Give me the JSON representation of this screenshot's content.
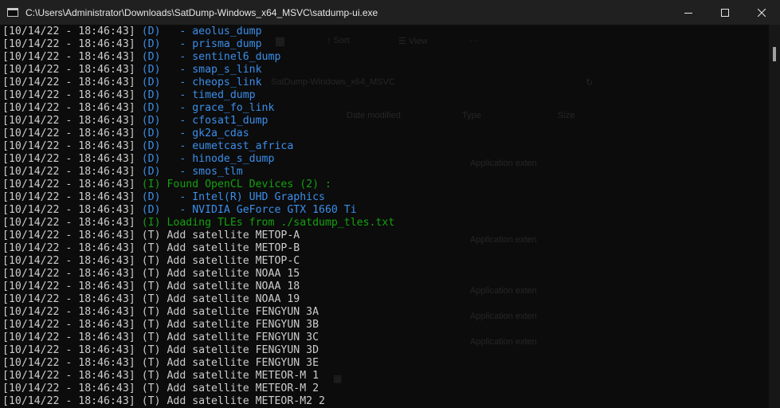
{
  "window": {
    "title": "C:\\Users\\Administrator\\Downloads\\SatDump-Windows_x64_MSVC\\satdump-ui.exe"
  },
  "colors": {
    "debug": "#3b8eea",
    "info": "#13a10e",
    "trace": "#cccccc"
  },
  "console": {
    "lines": [
      {
        "ts": "[10/14/22 - 18:46:43]",
        "level": "(D)",
        "msg": "  - aeolus_dump"
      },
      {
        "ts": "[10/14/22 - 18:46:43]",
        "level": "(D)",
        "msg": "  - prisma_dump"
      },
      {
        "ts": "[10/14/22 - 18:46:43]",
        "level": "(D)",
        "msg": "  - sentinel6_dump"
      },
      {
        "ts": "[10/14/22 - 18:46:43]",
        "level": "(D)",
        "msg": "  - smap_s_link"
      },
      {
        "ts": "[10/14/22 - 18:46:43]",
        "level": "(D)",
        "msg": "  - cheops_link"
      },
      {
        "ts": "[10/14/22 - 18:46:43]",
        "level": "(D)",
        "msg": "  - timed_dump"
      },
      {
        "ts": "[10/14/22 - 18:46:43]",
        "level": "(D)",
        "msg": "  - grace_fo_link"
      },
      {
        "ts": "[10/14/22 - 18:46:43]",
        "level": "(D)",
        "msg": "  - cfosat1_dump"
      },
      {
        "ts": "[10/14/22 - 18:46:43]",
        "level": "(D)",
        "msg": "  - gk2a_cdas"
      },
      {
        "ts": "[10/14/22 - 18:46:43]",
        "level": "(D)",
        "msg": "  - eumetcast_africa"
      },
      {
        "ts": "[10/14/22 - 18:46:43]",
        "level": "(D)",
        "msg": "  - hinode_s_dump"
      },
      {
        "ts": "[10/14/22 - 18:46:43]",
        "level": "(D)",
        "msg": "  - smos_tlm"
      },
      {
        "ts": "[10/14/22 - 18:46:43]",
        "level": "(I)",
        "msg": "Found OpenCL Devices (2) :"
      },
      {
        "ts": "[10/14/22 - 18:46:43]",
        "level": "(D)",
        "msg": "  - Intel(R) UHD Graphics"
      },
      {
        "ts": "[10/14/22 - 18:46:43]",
        "level": "(D)",
        "msg": "  - NVIDIA GeForce GTX 1660 Ti"
      },
      {
        "ts": "[10/14/22 - 18:46:43]",
        "level": "(I)",
        "msg": "Loading TLEs from ./satdump_tles.txt"
      },
      {
        "ts": "[10/14/22 - 18:46:43]",
        "level": "(T)",
        "msg": "Add satellite METOP-A"
      },
      {
        "ts": "[10/14/22 - 18:46:43]",
        "level": "(T)",
        "msg": "Add satellite METOP-B"
      },
      {
        "ts": "[10/14/22 - 18:46:43]",
        "level": "(T)",
        "msg": "Add satellite METOP-C"
      },
      {
        "ts": "[10/14/22 - 18:46:43]",
        "level": "(T)",
        "msg": "Add satellite NOAA 15"
      },
      {
        "ts": "[10/14/22 - 18:46:43]",
        "level": "(T)",
        "msg": "Add satellite NOAA 18"
      },
      {
        "ts": "[10/14/22 - 18:46:43]",
        "level": "(T)",
        "msg": "Add satellite NOAA 19"
      },
      {
        "ts": "[10/14/22 - 18:46:43]",
        "level": "(T)",
        "msg": "Add satellite FENGYUN 3A"
      },
      {
        "ts": "[10/14/22 - 18:46:43]",
        "level": "(T)",
        "msg": "Add satellite FENGYUN 3B"
      },
      {
        "ts": "[10/14/22 - 18:46:43]",
        "level": "(T)",
        "msg": "Add satellite FENGYUN 3C"
      },
      {
        "ts": "[10/14/22 - 18:46:43]",
        "level": "(T)",
        "msg": "Add satellite FENGYUN 3D"
      },
      {
        "ts": "[10/14/22 - 18:46:43]",
        "level": "(T)",
        "msg": "Add satellite FENGYUN 3E"
      },
      {
        "ts": "[10/14/22 - 18:46:43]",
        "level": "(T)",
        "msg": "Add satellite METEOR-M 1"
      },
      {
        "ts": "[10/14/22 - 18:46:43]",
        "level": "(T)",
        "msg": "Add satellite METEOR-M 2"
      },
      {
        "ts": "[10/14/22 - 18:46:43]",
        "level": "(T)",
        "msg": "Add satellite METEOR-M2 2"
      }
    ]
  }
}
